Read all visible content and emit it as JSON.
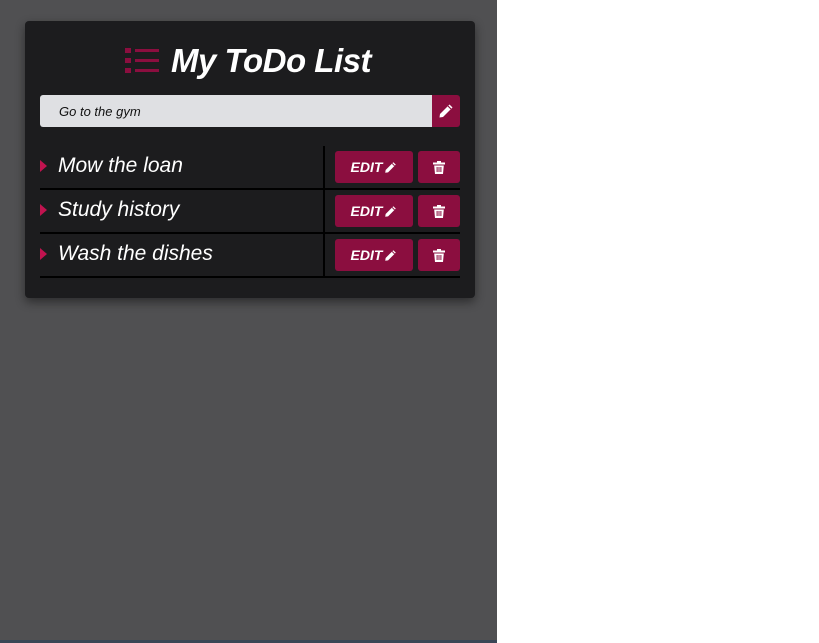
{
  "app": {
    "title": "My ToDo List",
    "accent_color": "#8b0e3f",
    "title_icon": "list-icon"
  },
  "input": {
    "value": "Go to the gym",
    "submit_icon": "pencil-icon"
  },
  "todos": [
    {
      "text": "Mow the loan",
      "edit_label": "EDIT",
      "edit_icon": "pencil-icon",
      "delete_icon": "trash-icon"
    },
    {
      "text": "Study history",
      "edit_label": "EDIT",
      "edit_icon": "pencil-icon",
      "delete_icon": "trash-icon"
    },
    {
      "text": "Wash the dishes",
      "edit_label": "EDIT",
      "edit_icon": "pencil-icon",
      "delete_icon": "trash-icon"
    }
  ]
}
